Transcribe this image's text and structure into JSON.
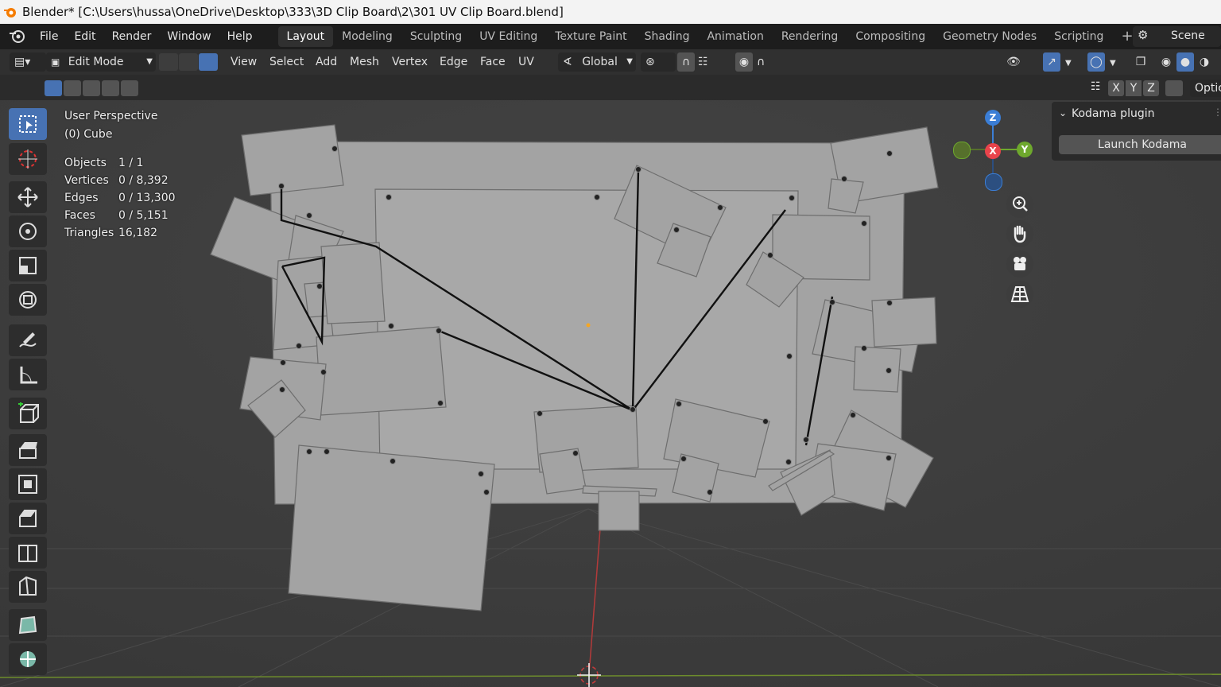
{
  "window": {
    "title": "Blender* [C:\\Users\\hussa\\OneDrive\\Desktop\\333\\3D Clip Board\\2\\301 UV Clip Board.blend]"
  },
  "menu": {
    "items": [
      "File",
      "Edit",
      "Render",
      "Window",
      "Help"
    ]
  },
  "workspaces": {
    "tabs": [
      "Layout",
      "Modeling",
      "Sculpting",
      "UV Editing",
      "Texture Paint",
      "Shading",
      "Animation",
      "Rendering",
      "Compositing",
      "Geometry Nodes",
      "Scripting"
    ],
    "active": "Layout",
    "add_symbol": "+"
  },
  "scene": {
    "label": "Scene"
  },
  "header": {
    "mode": "Edit Mode",
    "menus": [
      "View",
      "Select",
      "Add",
      "Mesh",
      "Vertex",
      "Edge",
      "Face",
      "UV"
    ],
    "transform_orientation": "Global"
  },
  "subheader": {
    "axes": [
      "X",
      "Y",
      "Z"
    ],
    "options_label": "Optic"
  },
  "overlay": {
    "view_name": "User Perspective",
    "object_name": "(0) Cube",
    "stats": [
      {
        "label": "Objects",
        "value": "1 / 1"
      },
      {
        "label": "Vertices",
        "value": "0 / 8,392"
      },
      {
        "label": "Edges",
        "value": "0 / 13,300"
      },
      {
        "label": "Faces",
        "value": "0 / 5,151"
      },
      {
        "label": "Triangles",
        "value": "16,182"
      }
    ]
  },
  "gizmo": {
    "z": "Z",
    "x": "X",
    "y": "Y"
  },
  "npanel": {
    "title": "Kodama plugin",
    "button": "Launch Kodama"
  },
  "colors": {
    "accent": "#4772b3",
    "x_axis": "#e8434b",
    "y_axis": "#6ea82d",
    "z_axis": "#3b7ed6"
  },
  "toolbar_icons": [
    "select-box-icon",
    "cursor-icon",
    "move-icon",
    "rotate-icon",
    "scale-icon",
    "transform-icon",
    "annotate-icon",
    "measure-icon",
    "add-cube-icon",
    "extrude-icon",
    "inset-icon",
    "bevel-icon",
    "loop-cut-icon",
    "knife-icon",
    "poly-build-icon",
    "spin-icon"
  ]
}
